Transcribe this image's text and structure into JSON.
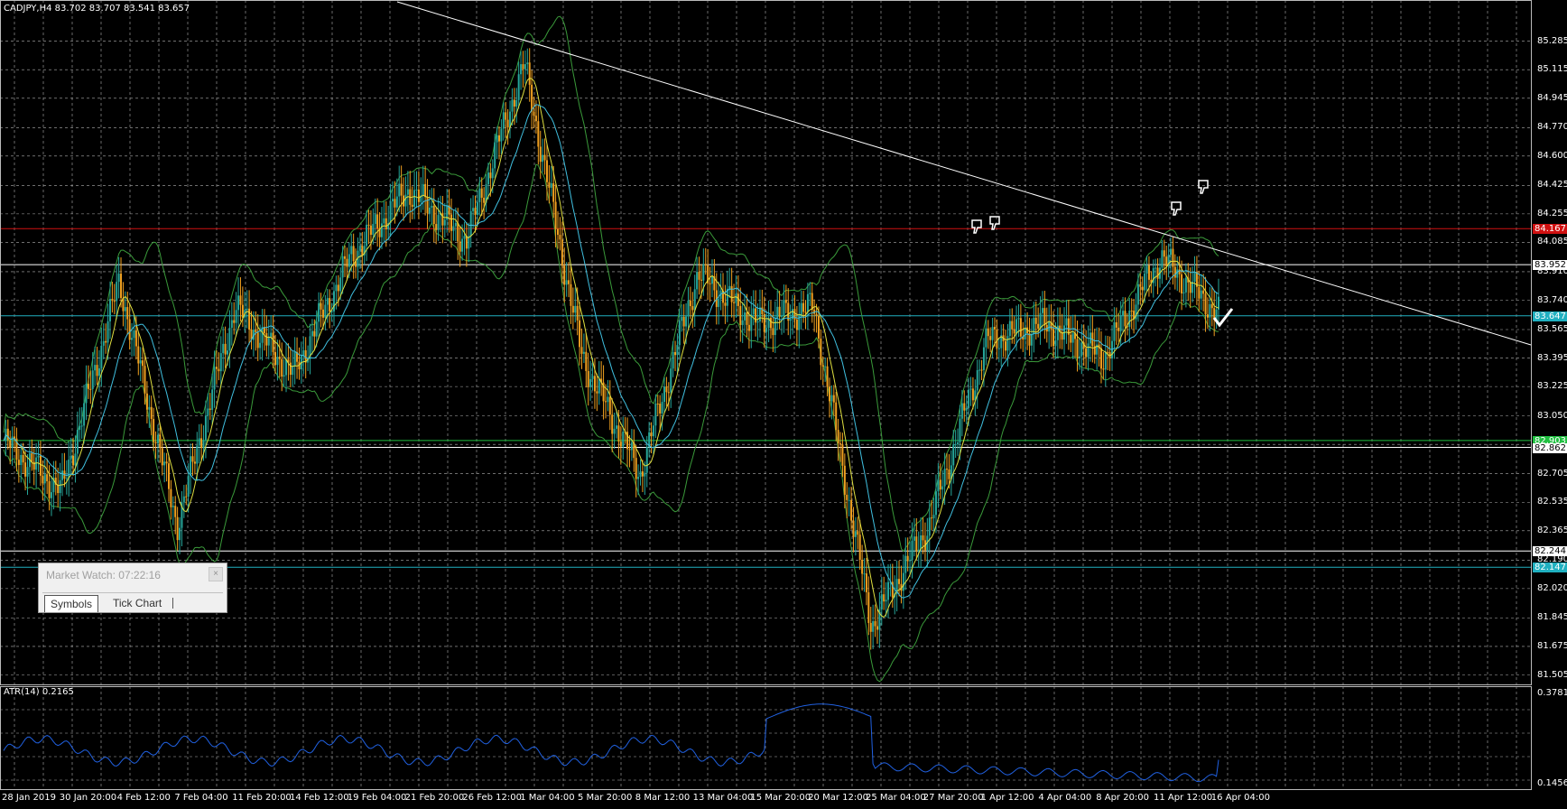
{
  "header": {
    "symbol_info": "CADJPY,H4  83.702 83.707 83.541 83.657"
  },
  "atr_header": "ATR(14) 0.2165",
  "price_axis": {
    "labels": [
      "85.285",
      "85.115",
      "84.945",
      "84.770",
      "84.600",
      "84.425",
      "84.255",
      "84.085",
      "83.910",
      "83.740",
      "83.565",
      "83.395",
      "83.225",
      "83.050",
      "82.880",
      "82.705",
      "82.535",
      "82.365",
      "82.190",
      "82.020",
      "81.845",
      "81.675",
      "81.505"
    ],
    "range": [
      81.47,
      85.38
    ]
  },
  "atr_axis": {
    "top": "0.3781",
    "bottom": "0.1456"
  },
  "time_axis": [
    "28 Jan 2019",
    "30 Jan 20:00",
    "4 Feb 12:00",
    "7 Feb 04:00",
    "11 Feb 20:00",
    "14 Feb 12:00",
    "19 Feb 04:00",
    "21 Feb 20:00",
    "26 Feb 12:00",
    "1 Mar 04:00",
    "5 Mar 20:00",
    "8 Mar 12:00",
    "13 Mar 04:00",
    "15 Mar 20:00",
    "20 Mar 12:00",
    "25 Mar 04:00",
    "27 Mar 20:00",
    "1 Apr 12:00",
    "4 Apr 04:00",
    "8 Apr 20:00",
    "11 Apr 12:00",
    "16 Apr 04:00"
  ],
  "price_tags": [
    {
      "value": "84.167",
      "price": 84.167,
      "color": "#d01010",
      "text": "#ffffff"
    },
    {
      "value": "83.952",
      "price": 83.952,
      "color": "#ffffff",
      "text": "#000000"
    },
    {
      "value": "83.647",
      "price": 83.647,
      "color": "#20b0c0",
      "text": "#ffffff"
    },
    {
      "value": "82.903",
      "price": 82.903,
      "color": "#20c040",
      "text": "#ffffff"
    },
    {
      "value": "82.862",
      "price": 82.862,
      "color": "#ffffff",
      "text": "#000000"
    },
    {
      "value": "82.244",
      "price": 82.244,
      "color": "#ffffff",
      "text": "#000000"
    },
    {
      "value": "82.147",
      "price": 82.147,
      "color": "#20b0c0",
      "text": "#ffffff"
    }
  ],
  "colors": {
    "bull": "#26a69a",
    "bear": "#f0a020",
    "grid": "#b0b0b0",
    "atr_line": "#2060e0",
    "trendline": "#ffffff",
    "bollinger": "#3a9a3a",
    "ma_fast": "#e0e040",
    "ma_slow": "#40c0e0"
  },
  "icons": [
    "thumbs-down-icon",
    "thumbs-down-icon",
    "thumbs-down-icon",
    "thumbs-down-icon",
    "check-icon"
  ],
  "market_watch": {
    "title": "Market Watch: 07:22:16",
    "close_label": "×",
    "tabs": [
      "Symbols",
      "Tick Chart"
    ]
  },
  "chart_data": {
    "type": "candlestick",
    "symbol": "CADJPY",
    "timeframe": "H4",
    "last": {
      "open": 83.702,
      "high": 83.707,
      "low": 83.541,
      "close": 83.657
    },
    "keypoints": [
      {
        "x": "28 Jan 2019",
        "y": 82.9
      },
      {
        "x": "30 Jan 20:00",
        "y": 82.6
      },
      {
        "x": "4 Feb 12:00",
        "y": 83.85
      },
      {
        "x": "7 Feb 04:00",
        "y": 82.4
      },
      {
        "x": "11 Feb 20:00",
        "y": 83.7
      },
      {
        "x": "14 Feb 12:00",
        "y": 83.3
      },
      {
        "x": "19 Feb 04:00",
        "y": 84.0
      },
      {
        "x": "21 Feb 20:00",
        "y": 84.4
      },
      {
        "x": "26 Feb 12:00",
        "y": 84.1
      },
      {
        "x": "1 Mar 04:00",
        "y": 85.15
      },
      {
        "x": "5 Mar 20:00",
        "y": 83.4
      },
      {
        "x": "8 Mar 12:00",
        "y": 82.7
      },
      {
        "x": "13 Mar 04:00",
        "y": 83.9
      },
      {
        "x": "15 Mar 20:00",
        "y": 83.6
      },
      {
        "x": "20 Mar 12:00",
        "y": 83.7
      },
      {
        "x": "25 Mar 04:00",
        "y": 81.8
      },
      {
        "x": "27 Mar 20:00",
        "y": 82.4
      },
      {
        "x": "1 Apr 12:00",
        "y": 83.5
      },
      {
        "x": "4 Apr 04:00",
        "y": 83.6
      },
      {
        "x": "8 Apr 20:00",
        "y": 83.4
      },
      {
        "x": "11 Apr 12:00",
        "y": 84.0
      },
      {
        "x": "16 Apr 04:00",
        "y": 83.66
      }
    ],
    "atr": {
      "name": "ATR(14)",
      "last": 0.2165,
      "range": [
        0.1456,
        0.3781
      ]
    }
  }
}
